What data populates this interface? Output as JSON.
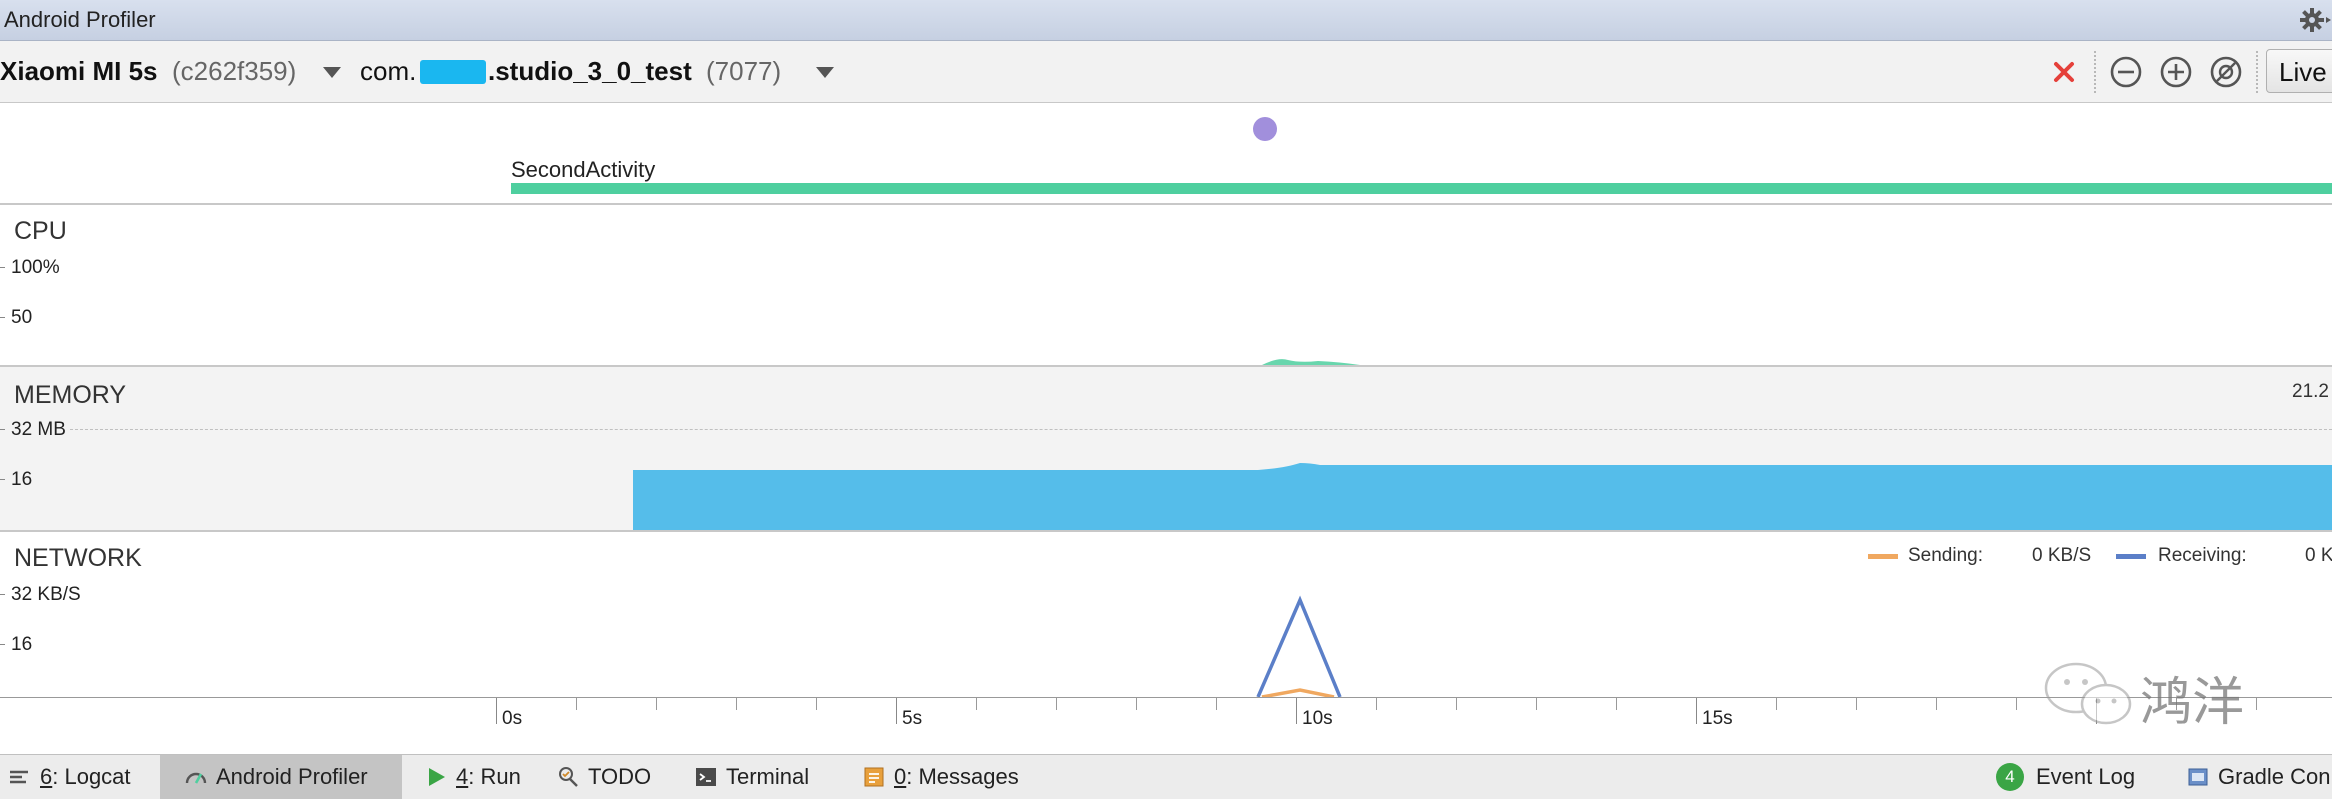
{
  "window": {
    "title": "Android Profiler"
  },
  "toolbar": {
    "device_name": "Xiaomi MI 5s",
    "device_id": "(c262f359)",
    "process_prefix": "com.",
    "process_name": ".studio_3_0_test",
    "process_pid": "(7077)",
    "live_label": "Live",
    "icons": [
      "stop-icon",
      "zoom-out-icon",
      "zoom-in-icon",
      "reset-zoom-icon"
    ],
    "colors": {
      "stop": "#e5403a",
      "redaction": "#1ab7f0"
    }
  },
  "events": {
    "activity_name": "SecondActivity",
    "colors": {
      "activity_bar": "#4ecf9f",
      "touch_dot": "#a18fdc"
    }
  },
  "cpu": {
    "label": "CPU",
    "axis_labels": [
      "100%",
      "50"
    ],
    "color": "#4ecf9f"
  },
  "memory": {
    "label": "MEMORY",
    "total_readout": "21.2",
    "axis_labels": [
      "32 MB",
      "16"
    ],
    "color": "#55bdea"
  },
  "network": {
    "label": "NETWORK",
    "axis_labels": [
      "32 KB/S",
      "16"
    ],
    "legend": [
      {
        "name": "Sending:",
        "value": "0 KB/S",
        "color": "#f0a860"
      },
      {
        "name": "Receiving:",
        "value": "0 K",
        "color": "#5b7fc8"
      }
    ]
  },
  "time_axis": {
    "labels": [
      "0s",
      "5s",
      "10s",
      "15s"
    ]
  },
  "bottom_bar": {
    "tabs": [
      {
        "key": "6",
        "label": ": Logcat"
      },
      {
        "label": "Android Profiler",
        "active": true
      },
      {
        "key": "4",
        "label": ": Run"
      },
      {
        "label": "TODO"
      },
      {
        "label": "Terminal"
      },
      {
        "key": "0",
        "label": ": Messages"
      }
    ],
    "event_log_count": "4",
    "event_log_label": "Event Log",
    "gradle_label": "Gradle Con"
  },
  "watermark": {
    "text": "鸿洋"
  }
}
